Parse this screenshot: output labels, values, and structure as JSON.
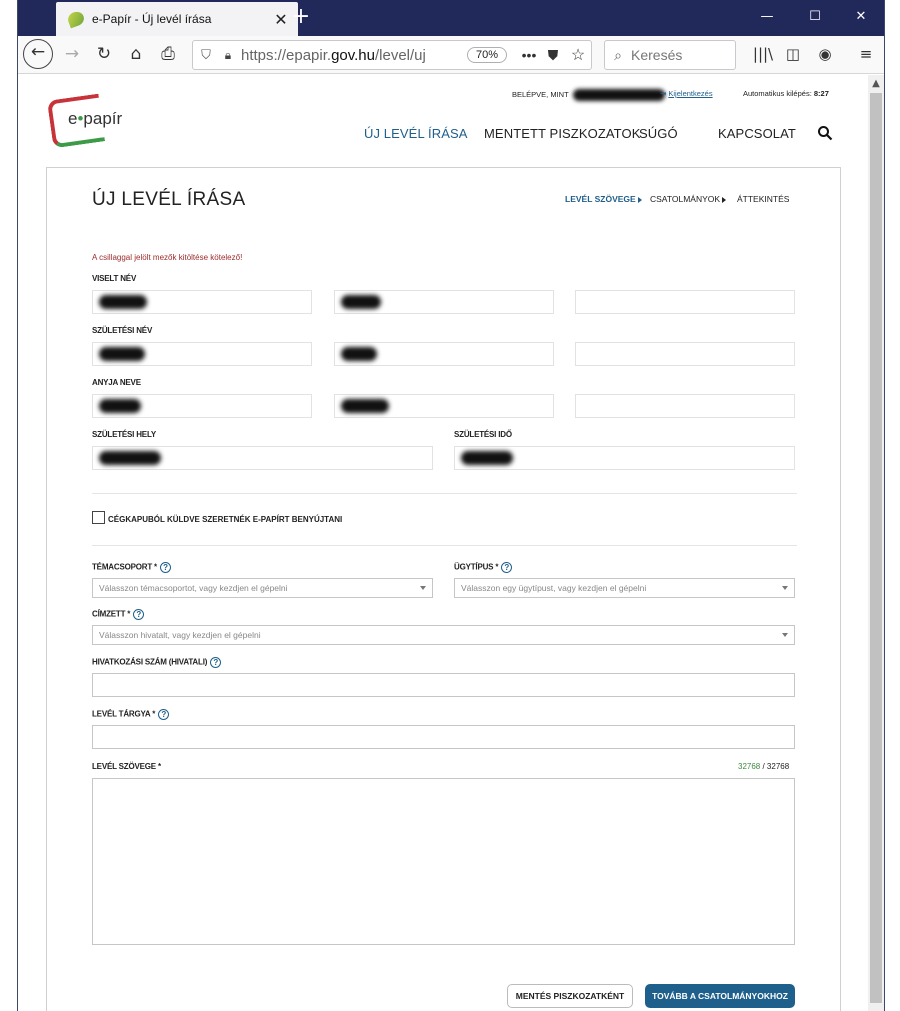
{
  "browser": {
    "tab_title": "e-Papír - Új levél írása",
    "new_tab": "+",
    "url_prefix": "https://epapir.",
    "url_domain": "gov.hu",
    "url_path": "/level/uj",
    "zoom": "70%",
    "search_placeholder": "Keresés",
    "win_minimize": "—",
    "win_maximize": "☐",
    "win_close": "✕"
  },
  "header": {
    "logo_text_e": "e",
    "logo_text_dot": "•",
    "logo_text_rest": "papír",
    "logged_in_label": "BELÉPVE, MINT",
    "logout_label": "Kijelentkezés",
    "auto_logout_label": "Automatikus kilépés:",
    "auto_logout_time": "8:27",
    "nav": [
      "ÚJ LEVÉL ÍRÁSA",
      "MENTETT PISZKOZATOK",
      "SÚGÓ",
      "KAPCSOLAT"
    ]
  },
  "form": {
    "title": "ÚJ LEVÉL ÍRÁSA",
    "steps": [
      "LEVÉL SZÖVEGE",
      "CSATOLMÁNYOK",
      "ÁTTEKINTÉS"
    ],
    "required_note": "A csillaggal jelölt mezők kitöltése kötelező!",
    "labels": {
      "viselt_nev": "VISELT NÉV",
      "szuletesi_nev": "SZÜLETÉSI NÉV",
      "anyja_neve": "ANYJA NEVE",
      "szuletesi_hely": "SZÜLETÉSI HELY",
      "szuletesi_ido": "SZÜLETÉSI IDŐ",
      "cegkapu": "CÉGKAPUBÓL KÜLDVE SZERETNÉK E-PAPÍRT BENYÚJTANI",
      "temacsoport": "TÉMACSOPORT",
      "ugytipus": "ÜGYTÍPUS",
      "cimzett": "CÍMZETT",
      "hivatkozasi_szam": "HIVATKOZÁSI SZÁM (HIVATALI)",
      "level_targya": "LEVÉL TÁRGYA",
      "level_szovege": "LEVÉL SZÖVEGE"
    },
    "required_marker": " *",
    "help_icon": "?",
    "placeholders": {
      "temacsoport": "Válasszon témacsoportot, vagy kezdjen el gépelni",
      "ugytipus": "Válasszon egy ügytípust, vagy kezdjen el gépelni",
      "cimzett": "Válasszon hivatalt, vagy kezdjen el gépelni"
    },
    "counter_remaining": "32768",
    "counter_total": " / 32768",
    "buttons": {
      "save_draft": "MENTÉS PISZKOZATKÉNT",
      "next": "TOVÁBB A CSATOLMÁNYOKHOZ"
    }
  },
  "colors": {
    "brand_blue": "#1f5f8b",
    "titlebar": "#20295a",
    "error_red": "#9c2b2b"
  }
}
